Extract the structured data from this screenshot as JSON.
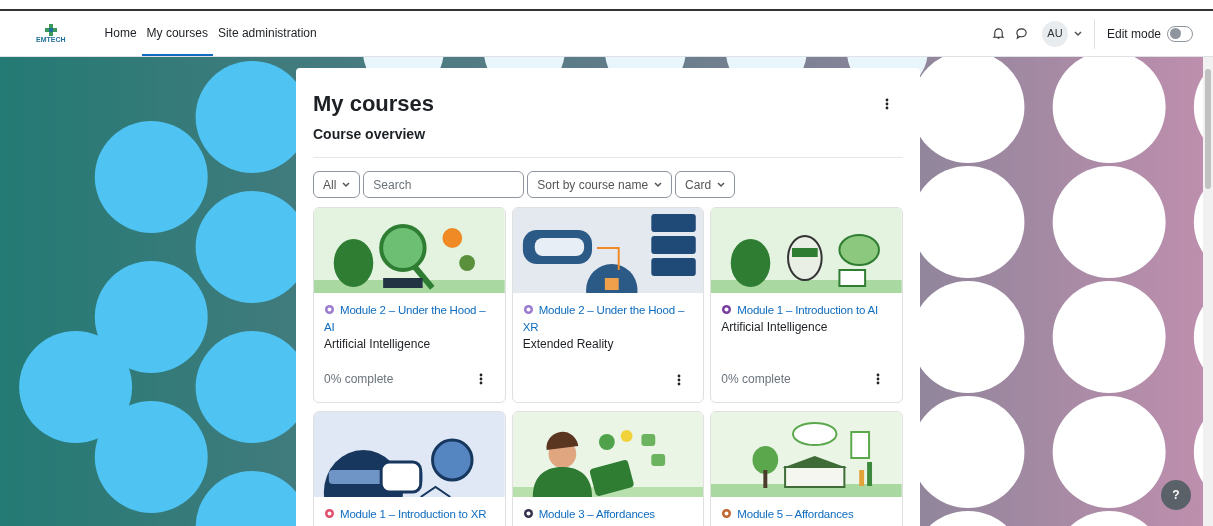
{
  "brand": {
    "logo_text": "EMTECH"
  },
  "nav": [
    {
      "label": "Home",
      "selected": false
    },
    {
      "label": "My courses",
      "selected": true
    },
    {
      "label": "Site administration",
      "selected": false
    }
  ],
  "header": {
    "avatar": "AU",
    "edit_mode": {
      "label": "Edit mode",
      "on": false
    }
  },
  "page": {
    "title": "My courses",
    "subtitle": "Course overview"
  },
  "filters": {
    "grouping": "All",
    "search": {
      "placeholder": "Search"
    },
    "sort": "Sort by course name",
    "view": "Card"
  },
  "courses": [
    {
      "title": "Module 2 – Under the Hood – AI",
      "category": "Artificial Intelligence",
      "progress": "0% complete",
      "menu": true
    },
    {
      "title": "Module 2 – Under the Hood – XR",
      "category": "Extended Reality",
      "menu": true
    },
    {
      "title": "Module 1 – Introduction to AI",
      "category": "Artificial Intelligence",
      "progress": "0% complete",
      "menu": true
    },
    {
      "title": "Module 1 – Introduction to XR"
    },
    {
      "title": "Module 3 – Affordances"
    },
    {
      "title": "Module 5 – Affordances"
    }
  ],
  "help": {
    "label": "?"
  }
}
